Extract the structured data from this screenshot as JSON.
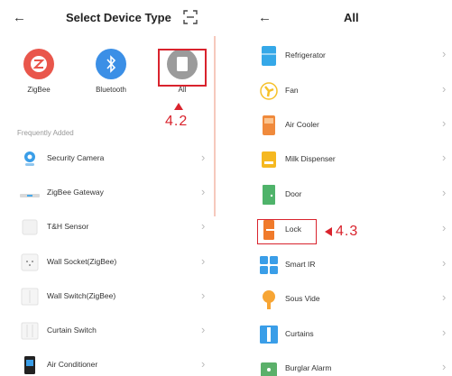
{
  "left_screen": {
    "title": "Select Device Type",
    "back_glyph": "←",
    "scan_icon": "scan-icon",
    "types": [
      {
        "label": "ZigBee",
        "icon": "zigbee-icon",
        "color": "#e9564b"
      },
      {
        "label": "Bluetooth",
        "icon": "bluetooth-icon",
        "color": "#3b8fe6"
      },
      {
        "label": "All",
        "icon": "all-devices-icon",
        "color": "#9b9b9b"
      }
    ],
    "annotation": "4.2",
    "section_label": "Frequently Added",
    "items": [
      {
        "label": "Security Camera",
        "icon": "security-camera-icon"
      },
      {
        "label": "ZigBee Gateway",
        "icon": "gateway-icon"
      },
      {
        "label": "T&H Sensor",
        "icon": "th-sensor-icon"
      },
      {
        "label": "Wall Socket(ZigBee)",
        "icon": "wall-socket-icon"
      },
      {
        "label": "Wall Switch(ZigBee)",
        "icon": "wall-switch-icon"
      },
      {
        "label": "Curtain Switch",
        "icon": "curtain-switch-icon"
      },
      {
        "label": "Air Conditioner",
        "icon": "air-conditioner-icon"
      }
    ]
  },
  "right_screen": {
    "title": "All",
    "back_glyph": "←",
    "annotation": "4.3",
    "items": [
      {
        "label": "Refrigerator",
        "icon": "refrigerator-icon",
        "color": "#35a8e8"
      },
      {
        "label": "Fan",
        "icon": "fan-icon",
        "color": "#f6c12a"
      },
      {
        "label": "Air Cooler",
        "icon": "air-cooler-icon",
        "color": "#f08a3c"
      },
      {
        "label": "Milk Dispenser",
        "icon": "milk-dispenser-icon",
        "color": "#f5b820"
      },
      {
        "label": "Door",
        "icon": "door-icon",
        "color": "#4fb36a"
      },
      {
        "label": "Lock",
        "icon": "lock-icon",
        "color": "#f07a2a"
      },
      {
        "label": "Smart IR",
        "icon": "smart-ir-icon",
        "color": "#3a9ee8"
      },
      {
        "label": "Sous Vide",
        "icon": "sous-vide-icon",
        "color": "#f7a534"
      },
      {
        "label": "Curtains",
        "icon": "curtains-icon",
        "color": "#3a9ee8"
      },
      {
        "label": "Burglar Alarm",
        "icon": "burglar-alarm-icon",
        "color": "#5bb06a"
      }
    ]
  },
  "chevron_glyph": "›"
}
